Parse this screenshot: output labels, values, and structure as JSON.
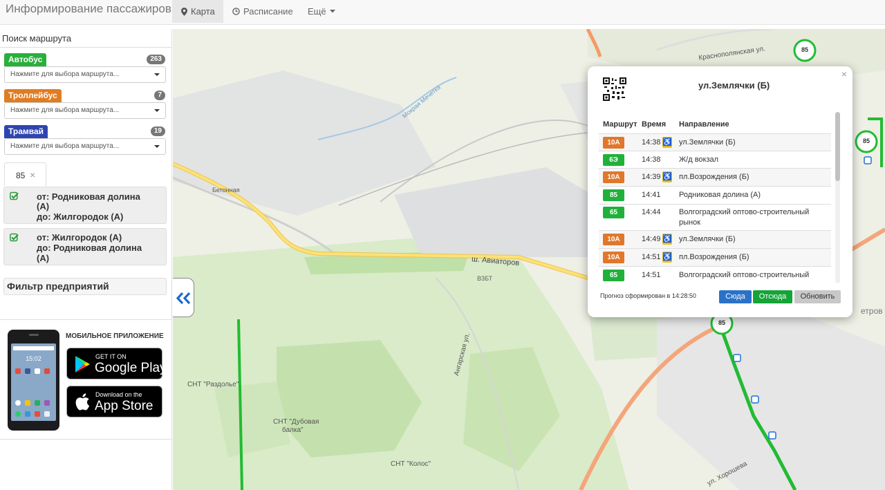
{
  "navbar": {
    "brand": "Информирование пассажиров",
    "items": [
      {
        "label": "Карта",
        "icon": "map-marker-icon",
        "active": true
      },
      {
        "label": "Расписание",
        "icon": "clock-icon",
        "active": false
      },
      {
        "label": "Ещё",
        "icon": "caret-down-icon",
        "active": false
      }
    ]
  },
  "sidebar": {
    "title": "Поиск маршрута",
    "transport": [
      {
        "label": "Автобус",
        "count": "263",
        "color": "#27b03a",
        "placeholder": "Нажмите для выбора маршрута..."
      },
      {
        "label": "Троллейбус",
        "count": "7",
        "color": "#e07c22",
        "placeholder": "Нажмите для выбора маршрута..."
      },
      {
        "label": "Трамвай",
        "count": "19",
        "color": "#2e45b0",
        "placeholder": "Нажмите для выбора маршрута..."
      }
    ],
    "selected_route": "85",
    "directions": [
      {
        "from": "от: Родниковая долина",
        "from_cont": "(А)",
        "to": "до: Жилгородок (А)",
        "to_cont": ""
      },
      {
        "from": "от: Жилгородок (А)",
        "from_cont": "",
        "to": "до: Родниковая долина",
        "to_cont": "(А)"
      }
    ],
    "filter_title": "Фильтр предприятий",
    "app": {
      "title": "МОБИЛЬНОЕ ПРИЛОЖЕНИЕ",
      "google_small": "GET IT ON",
      "google_big": "Google Play",
      "apple_small": "Download on the",
      "apple_big": "App Store",
      "phone_time": "15:02"
    }
  },
  "map": {
    "labels": [
      {
        "text": "Краснополянская ул."
      },
      {
        "text": "Мокрая Мечетка"
      },
      {
        "text": "Бетонная"
      },
      {
        "text": "ш. Авиаторов"
      },
      {
        "text": "ВЗБТ"
      },
      {
        "text": "Ангарская ул."
      },
      {
        "text": "СНТ \"Раздолье\""
      },
      {
        "text": "СНТ \"Дубовая"
      },
      {
        "text": "балка\""
      },
      {
        "text": "СНТ \"Колос\""
      },
      {
        "text": "ул. Хорошева"
      },
      {
        "text": "етров"
      }
    ],
    "route_markers": [
      "85",
      "85",
      "85"
    ],
    "colors": {
      "route": "#22bb33",
      "highway": "#f5d142",
      "arterial": "#f59a66"
    }
  },
  "popup": {
    "close": "×",
    "stop_name": "ул.Землячки (Б)",
    "headers": {
      "route": "Маршрут",
      "time": "Время",
      "direction": "Направление"
    },
    "rows": [
      {
        "route": "10А",
        "type": "trolleybus",
        "time": "14:38",
        "accessible": true,
        "direction": "ул.Землячки (Б)"
      },
      {
        "route": "6Э",
        "type": "bus",
        "time": "14:38",
        "accessible": false,
        "direction": "Ж/д вокзал"
      },
      {
        "route": "10А",
        "type": "trolleybus",
        "time": "14:39",
        "accessible": true,
        "direction": "пл.Возрождения (Б)"
      },
      {
        "route": "85",
        "type": "bus",
        "time": "14:41",
        "accessible": false,
        "direction": "Родниковая долина (А)"
      },
      {
        "route": "65",
        "type": "bus",
        "time": "14:44",
        "accessible": false,
        "direction": "Волгоградский оптово-строительный рынок"
      },
      {
        "route": "10А",
        "type": "trolleybus",
        "time": "14:49",
        "accessible": true,
        "direction": "ул.Землячки (Б)"
      },
      {
        "route": "10А",
        "type": "trolleybus",
        "time": "14:51",
        "accessible": true,
        "direction": "пл.Возрождения (Б)"
      },
      {
        "route": "65",
        "type": "bus",
        "time": "14:51",
        "accessible": false,
        "direction": "Волгоградский оптово-строительный рынок"
      }
    ],
    "forecast": "Прогноз сформирован в 14:28:50",
    "buttons": {
      "here": "Сюда",
      "from": "Отсюда",
      "refresh": "Обновить"
    },
    "colors": {
      "bus": "#21b13a",
      "trolleybus": "#e0772a",
      "btn_blue": "#2a72c8",
      "btn_green": "#14a437",
      "btn_gray": "#c8c8c8"
    }
  }
}
